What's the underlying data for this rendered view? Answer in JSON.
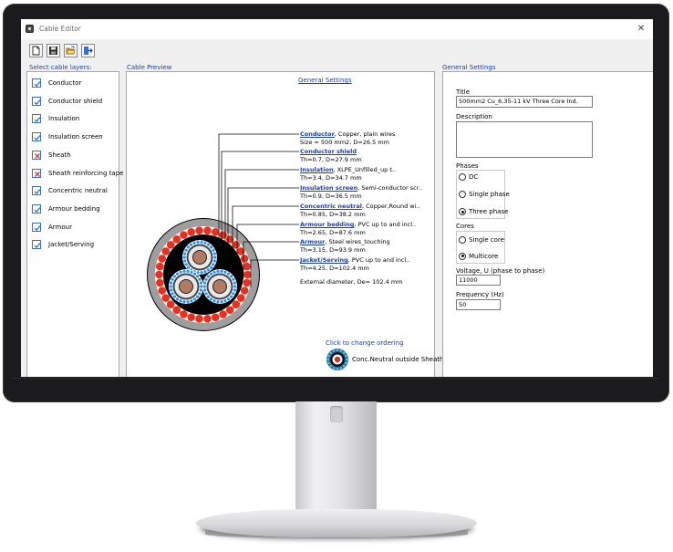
{
  "window": {
    "title": "Cable Editor",
    "close_glyph": "✕"
  },
  "toolbar": {
    "buttons": [
      "new-file-icon",
      "save-icon",
      "open-folder-icon",
      "exit-icon"
    ]
  },
  "layers": {
    "title": "Select cable layers:",
    "items": [
      {
        "label": "Conductor",
        "checked": true
      },
      {
        "label": "Conductor shield",
        "checked": true
      },
      {
        "label": "Insulation",
        "checked": true
      },
      {
        "label": "Insulation screen",
        "checked": true
      },
      {
        "label": "Sheath",
        "checked": false
      },
      {
        "label": "Sheath reinforcing tape",
        "checked": false
      },
      {
        "label": "Concentric neutral",
        "checked": true
      },
      {
        "label": "Armour bedding",
        "checked": true
      },
      {
        "label": "Armour",
        "checked": true
      },
      {
        "label": "Jacket/Serving",
        "checked": true
      }
    ]
  },
  "preview": {
    "title": "Cable Preview",
    "settings_link": "General Settings",
    "legend": [
      {
        "name": "Conductor",
        "desc": ", Copper, plain wires",
        "dims": "Size = 500 mm2, D=26.5 mm"
      },
      {
        "name": "Conductor shield",
        "desc": "",
        "dims": "Th=0.7, D=27.9 mm"
      },
      {
        "name": "Insulation",
        "desc": ", XLPE_Unfilled_up t..",
        "dims": "Th=3.4, D=34.7 mm"
      },
      {
        "name": "Insulation screen",
        "desc": ", Semi-conductor scr..",
        "dims": "Th=0.9, D=36.5 mm"
      },
      {
        "name": "Concentric neutral",
        "desc": ", Copper,Round wi..",
        "dims": "Th=0.85, D=38.2 mm"
      },
      {
        "name": "Armour bedding",
        "desc": ", PVC up to and incl..",
        "dims": "Th=2.65, D=87.6 mm"
      },
      {
        "name": "Armour",
        "desc": ", Steel wires_touching",
        "dims": "Th=3.15, D=93.9 mm"
      },
      {
        "name": "Jacket/Serving",
        "desc": ", PVC up to and incl..",
        "dims": "Th=4.25, D=102.4 mm"
      }
    ],
    "external_diameter": "External diameter, De= 102.4 mm",
    "ordering_link": "Click to change ordering",
    "ordering_label": "Conc.Neutral outside Sheath"
  },
  "settings": {
    "title": "General Settings",
    "title_label": "Title",
    "title_value": "500mm2 Cu_6.35-11 kV Three Core Ind.",
    "description_label": "Description",
    "description_value": "",
    "phases_label": "Phases",
    "phases": [
      {
        "label": "DC",
        "selected": false
      },
      {
        "label": "Single phase",
        "selected": false
      },
      {
        "label": "Three phase",
        "selected": true
      }
    ],
    "cores_label": "Cores",
    "cores": [
      {
        "label": "Single core",
        "selected": false
      },
      {
        "label": "Multicore",
        "selected": true
      }
    ],
    "voltage_label": "Voltage, U (phase to phase)",
    "voltage_value": "11000",
    "frequency_label": "Frequency (Hz)",
    "frequency_value": "50"
  },
  "colors": {
    "accent": "#1a3fb3",
    "jacket": "#9e9e9e",
    "armour_wire": "#e8301f",
    "bedding": "#000000",
    "neutral_wire": "#1e90ff",
    "conductor": "#b07a63"
  }
}
